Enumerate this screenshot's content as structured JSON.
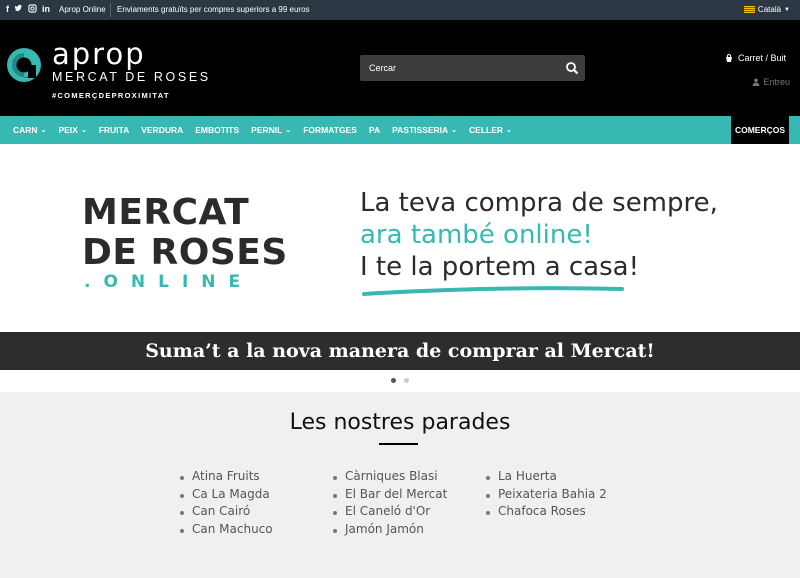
{
  "topbar": {
    "site_link": "Aprop Online",
    "shipping_notice": "Enviaments gratuïts per compres superiors a 99 euros",
    "language": "Català"
  },
  "header": {
    "brand_name": "aprop",
    "brand_subtitle": "MERCAT DE ROSES",
    "brand_tagline": "#COMERÇDEPROXIMITAT",
    "search_placeholder": "Cercar",
    "cart_label": "Carret / Buit",
    "login_label": "Entreu"
  },
  "nav": {
    "items": [
      {
        "label": "CARN",
        "dropdown": true
      },
      {
        "label": "PEIX",
        "dropdown": true
      },
      {
        "label": "FRUITA",
        "dropdown": false
      },
      {
        "label": "VERDURA",
        "dropdown": false
      },
      {
        "label": "EMBOTITS",
        "dropdown": false
      },
      {
        "label": "PERNIL",
        "dropdown": true
      },
      {
        "label": "FORMATGES",
        "dropdown": false
      },
      {
        "label": "PA",
        "dropdown": false
      },
      {
        "label": "PASTISSERIA",
        "dropdown": true
      },
      {
        "label": "CELLER",
        "dropdown": true
      }
    ],
    "highlight": "COMERÇOS"
  },
  "banner": {
    "logo_line1": "MERCAT",
    "logo_line2": "DE ROSES",
    "logo_line3": ".ONLINE",
    "tagline_line1": "La teva compra de sempre,",
    "tagline_line2": "ara també online!",
    "tagline_line3": "I te la portem a casa!",
    "strip_text": "Suma’t a la nova manera de comprar al Mercat!"
  },
  "slider": {
    "active_slide": 1,
    "total_slides": 2
  },
  "stalls": {
    "title": "Les nostres parades",
    "columns": [
      [
        "Atina Fruits",
        "Ca La Magda",
        "Can Cairó",
        "Can Machuco"
      ],
      [
        "Càrniques Blasi",
        "El Bar del Mercat",
        "El Caneló d'Or",
        "Jamón Jamón"
      ],
      [
        "La Huerta",
        "Peixateria Bahia 2",
        "Chafoca Roses"
      ]
    ]
  },
  "colors": {
    "accent": "#38b8b2",
    "header_bg": "#000000",
    "topbar_bg": "#2b3742",
    "strip_bg": "#2d2d2d",
    "section_bg": "#f0f0f0"
  },
  "icons": [
    "facebook-icon",
    "twitter-icon",
    "instagram-icon",
    "linkedin-icon",
    "flag-icon",
    "search-icon",
    "cart-icon",
    "user-icon",
    "chevron-down-icon"
  ]
}
